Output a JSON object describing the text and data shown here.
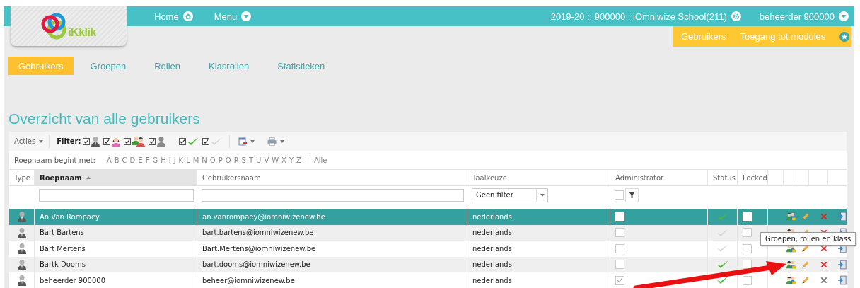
{
  "header": {
    "nav": [
      {
        "label": "Home"
      },
      {
        "label": "Menu"
      }
    ],
    "school": "2019-20 :: 900000 : iOmniwize School(211)",
    "user": "beheerder 900000",
    "logo_text": "iKklik",
    "quick_links": [
      "Gebruikers",
      "Toegang tot modules"
    ]
  },
  "tabs": [
    {
      "label": "Gebruikers",
      "selected": true
    },
    {
      "label": "Groepen",
      "selected": false
    },
    {
      "label": "Rollen",
      "selected": false
    },
    {
      "label": "Klasrollen",
      "selected": false
    },
    {
      "label": "Statistieken",
      "selected": false
    }
  ],
  "heading": "Overzicht van alle gebruikers",
  "toolbar": {
    "actions": "Acties",
    "filter_label": "Filter:",
    "filters": [
      {
        "kind": "teacher",
        "checked": true
      },
      {
        "kind": "student",
        "checked": true
      },
      {
        "kind": "parents",
        "checked": true
      },
      {
        "kind": "other",
        "checked": true
      },
      {
        "kind": "active",
        "checked": true
      },
      {
        "kind": "inactive",
        "checked": true
      }
    ]
  },
  "alphabet": {
    "label": "Roepnaam begint met:",
    "letters": [
      "A",
      "B",
      "C",
      "D",
      "E",
      "F",
      "G",
      "H",
      "I",
      "J",
      "K",
      "L",
      "M",
      "N",
      "O",
      "P",
      "Q",
      "R",
      "S",
      "T",
      "U",
      "V",
      "W",
      "X",
      "Y",
      "Z"
    ],
    "all": "Alle"
  },
  "table": {
    "columns": [
      {
        "label": "Type",
        "sorted": false
      },
      {
        "label": "Roepnaam",
        "sorted": true
      },
      {
        "label": "Gebruikersnaam",
        "sorted": false
      },
      {
        "label": "Taalkeuze",
        "sorted": false
      },
      {
        "label": "Administrator",
        "sorted": false
      },
      {
        "label": "Status",
        "sorted": false
      },
      {
        "label": "Locked",
        "sorted": false
      }
    ],
    "language_filter": "Geen filter",
    "admin_filter_checked": false,
    "rows": [
      {
        "name": "An Van Rompaey",
        "username": "an.vanrompaey@iomniwizenew.be",
        "language": "nederlands",
        "admin": false,
        "active": true,
        "locked": false,
        "deletable": true,
        "selected": true
      },
      {
        "name": "Bart Bartens",
        "username": "bart.bartens@iomniwizenew.be",
        "language": "nederlands",
        "admin": false,
        "active": false,
        "locked": false,
        "deletable": true,
        "selected": false
      },
      {
        "name": "Bart Mertens",
        "username": "Bart.Mertens@iomniwizenew.be",
        "language": "nederlands",
        "admin": false,
        "active": false,
        "locked": false,
        "deletable": true,
        "selected": false
      },
      {
        "name": "Bartk Dooms",
        "username": "bart.dooms@iomniwizenew.be",
        "language": "nederlands",
        "admin": false,
        "active": true,
        "locked": false,
        "deletable": true,
        "selected": false
      },
      {
        "name": "beheerder 900000",
        "username": "beheer@iomniwizenew.be",
        "language": "nederlands",
        "admin": true,
        "active": true,
        "locked": false,
        "deletable": false,
        "selected": false
      }
    ]
  },
  "tooltip": "Groepen, rollen en klass"
}
